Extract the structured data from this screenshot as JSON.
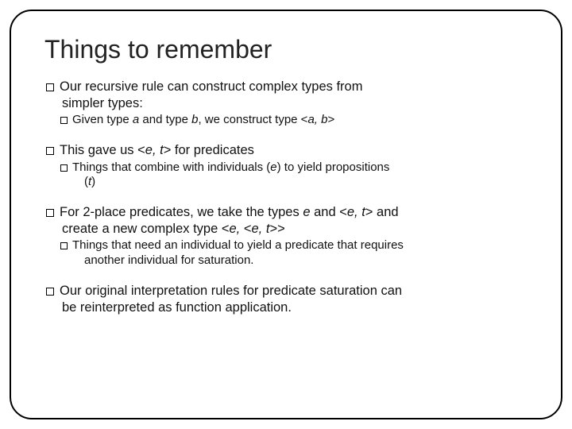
{
  "title": "Things to remember",
  "b1": "Our recursive rule can construct complex types from",
  "b1c": "simpler types:",
  "b1s1a": "Given type ",
  "b1s1b": "a",
  "b1s1c": " and type ",
  "b1s1d": "b",
  "b1s1e": ", we construct type <",
  "b1s1f": "a, b",
  "b1s1g": ">",
  "b2a": "This gave us <",
  "b2b": "e, t",
  "b2c": "> for predicates",
  "b2s1a": "Things that combine with individuals (",
  "b2s1b": "e",
  "b2s1c": ") to yield propositions",
  "b2s1d": "(",
  "b2s1e": "t",
  "b2s1f": ")",
  "b3a": "For 2-place predicates, we take the types ",
  "b3b": "e",
  "b3c": " and  <",
  "b3d": "e, t",
  "b3e": "> and",
  "b3f": "create a new complex type <",
  "b3g": "e, ",
  "b3h": "<",
  "b3i": "e, t",
  "b3j": ">>",
  "b3s1a": "Things that need an individual to yield a predicate that requires",
  "b3s1b": "another individual for saturation.",
  "b4a": "Our original interpretation rules for predicate saturation can",
  "b4b": "be reinterpreted as function application."
}
